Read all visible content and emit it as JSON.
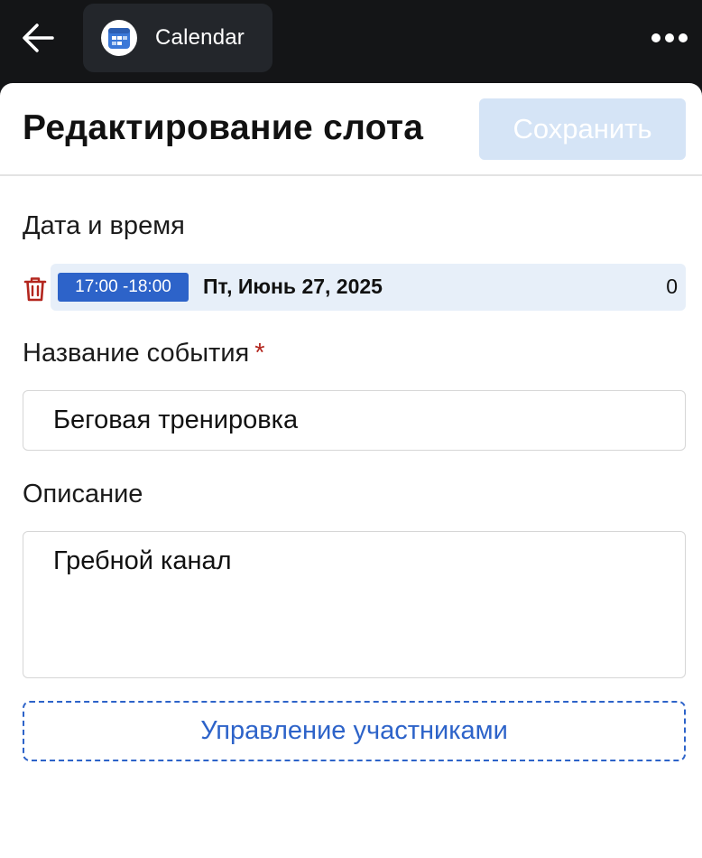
{
  "topbar": {
    "app_title": "Calendar"
  },
  "header": {
    "title": "Редактирование слота",
    "save_label": "Сохранить"
  },
  "datetime": {
    "label": "Дата и время",
    "slot": {
      "time": "17:00 -18:00",
      "date": "Пт, Июнь 27, 2025",
      "count": "0"
    }
  },
  "event_name": {
    "label": "Название события",
    "required_mark": "*",
    "value": "Беговая тренировка"
  },
  "description": {
    "label": "Описание",
    "value": "Гребной канал"
  },
  "participants": {
    "manage_label": "Управление участниками"
  },
  "colors": {
    "accent": "#2d63c9",
    "save_disabled": "#d5e4f6",
    "danger": "#b3261e",
    "slot_bg": "#e7eff9",
    "topbar_bg": "#141517"
  },
  "icons": {
    "back": "arrow-left-icon",
    "app": "calendar-icon",
    "more": "more-horizontal-icon",
    "delete": "trash-icon"
  }
}
